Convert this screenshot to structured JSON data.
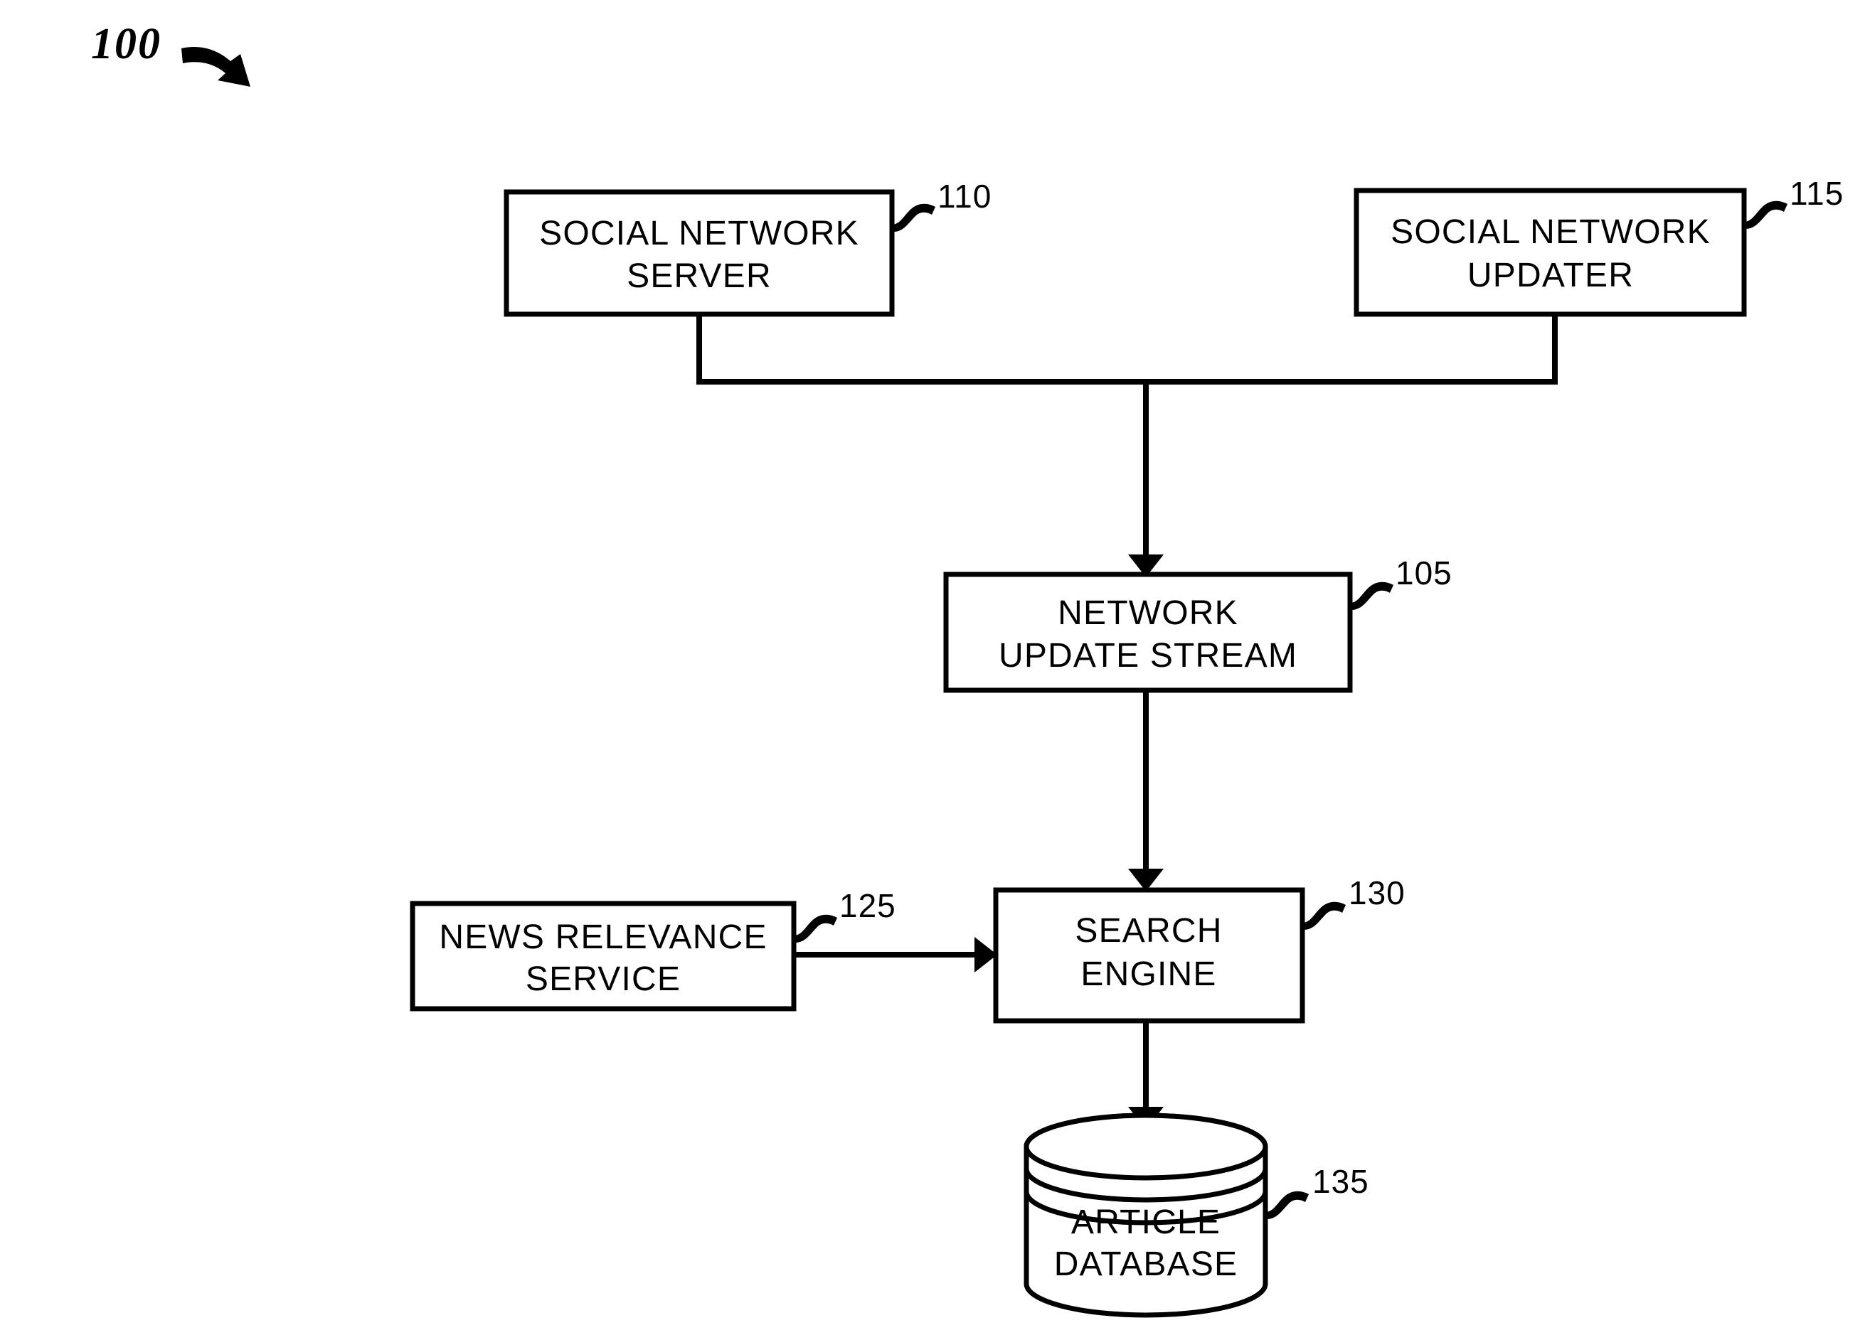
{
  "figure": {
    "number": "100",
    "pointer_icon": "curved-arrow-icon"
  },
  "nodes": [
    {
      "id": "social-network-server",
      "ref": "110",
      "line1": "SOCIAL NETWORK",
      "line2": "SERVER",
      "shape": "rectangle"
    },
    {
      "id": "social-network-updater",
      "ref": "115",
      "line1": "SOCIAL NETWORK",
      "line2": "UPDATER",
      "shape": "rectangle"
    },
    {
      "id": "network-update-stream",
      "ref": "105",
      "line1": "NETWORK",
      "line2": "UPDATE STREAM",
      "shape": "rectangle"
    },
    {
      "id": "news-relevance-service",
      "ref": "125",
      "line1": "NEWS RELEVANCE",
      "line2": "SERVICE",
      "shape": "rectangle"
    },
    {
      "id": "search-engine",
      "ref": "130",
      "line1": "SEARCH",
      "line2": "ENGINE",
      "shape": "rectangle"
    },
    {
      "id": "article-database",
      "ref": "135",
      "line1": "ARTICLE",
      "line2": "DATABASE",
      "shape": "cylinder"
    }
  ],
  "connections": [
    {
      "from": "social-network-server",
      "to": "network-update-stream",
      "arrow": true
    },
    {
      "from": "social-network-updater",
      "to": "network-update-stream",
      "arrow": true
    },
    {
      "from": "network-update-stream",
      "to": "search-engine",
      "arrow": true
    },
    {
      "from": "news-relevance-service",
      "to": "search-engine",
      "arrow": true
    },
    {
      "from": "search-engine",
      "to": "article-database",
      "arrow": true
    }
  ],
  "colors": {
    "stroke": "#000000",
    "background": "#ffffff"
  }
}
